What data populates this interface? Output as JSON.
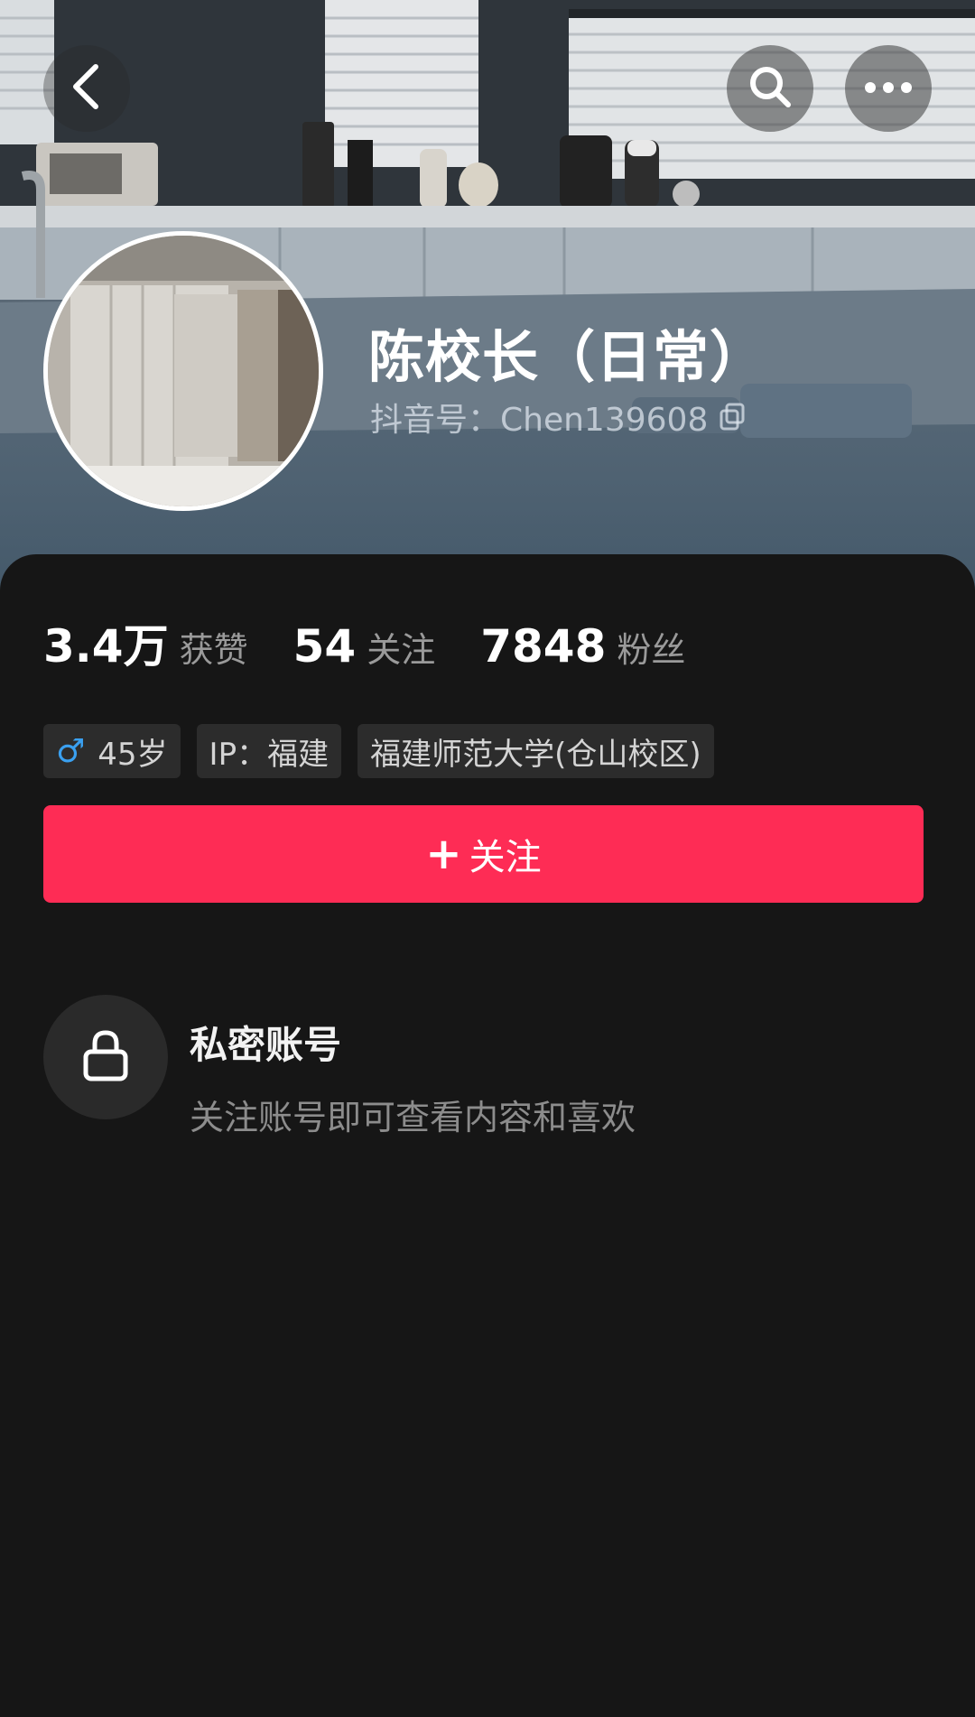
{
  "header": {
    "username": "陈校长（日常）",
    "douyin_id": "抖音号：Chen139608"
  },
  "icons": {
    "back": "chevron-left-icon",
    "search": "search-icon",
    "more": "more-horizontal-icon",
    "copy": "copy-icon",
    "male": "male-icon",
    "plus": "plus-icon",
    "lock": "lock-icon"
  },
  "stats": [
    {
      "value": "3.4万",
      "label": "获赞"
    },
    {
      "value": "54",
      "label": "关注"
    },
    {
      "value": "7848",
      "label": "粉丝"
    }
  ],
  "tags": {
    "gender_symbol": "♂",
    "age": "45岁",
    "ip": "IP：福建",
    "school": "福建师范大学(仓山校区)"
  },
  "follow_button": {
    "plus": "+",
    "label": "关注"
  },
  "private_account": {
    "title": "私密账号",
    "subtitle": "关注账号即可查看内容和喜欢"
  },
  "colors": {
    "accent": "#fe2c55",
    "background": "#161616",
    "male_blue": "#3aa0f0"
  }
}
